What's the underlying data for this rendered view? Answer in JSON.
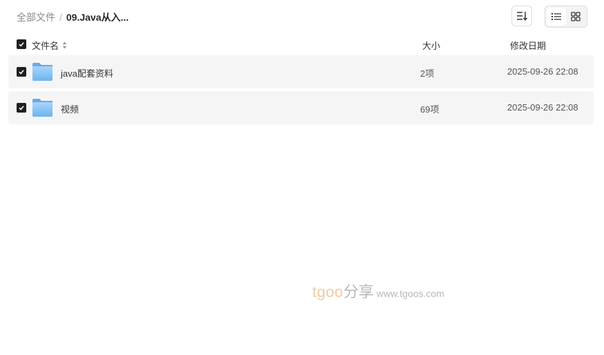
{
  "breadcrumb": {
    "root": "全部文件",
    "separator": "/",
    "current": "09.Java从入..."
  },
  "toolbar": {
    "sort_icon": "sort-list-icon",
    "views": [
      {
        "icon": "list-view-icon",
        "active": true
      },
      {
        "icon": "grid-view-icon",
        "active": false
      }
    ]
  },
  "table": {
    "columns": {
      "name": "文件名",
      "size": "大小",
      "date": "修改日期"
    },
    "select_all": true,
    "rows": [
      {
        "name": "java配套资料",
        "size": "2项",
        "date": "2025-09-26 22:08",
        "checked": true,
        "icon": "folder-icon"
      },
      {
        "name": "视频",
        "size": "69项",
        "date": "2025-09-26 22:08",
        "checked": true,
        "icon": "folder-icon"
      }
    ]
  },
  "watermark": {
    "brand": "tgoo",
    "cn": "分享",
    "url": "www.tgoos.com"
  },
  "colors": {
    "row_bg": "#f5f5f5",
    "checkbox": "#1f1f1f",
    "folder": "#7cbcf3"
  }
}
